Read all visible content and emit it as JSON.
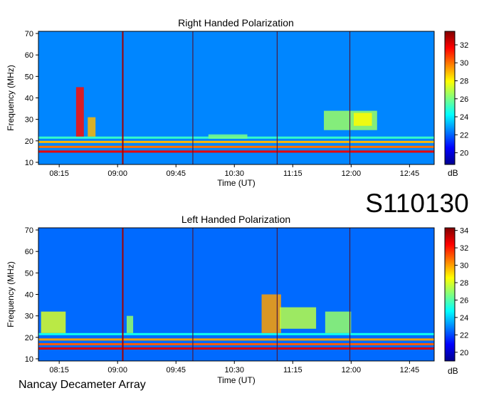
{
  "observatory_label": "Nancay Decameter Array",
  "dataset_code": "S110130",
  "chart_data": [
    {
      "type": "heatmap",
      "title": "Right Handed Polarization",
      "xlabel": "Time (UT)",
      "ylabel": "Frequency (MHz)",
      "x_ticks": [
        "08:15",
        "09:00",
        "09:45",
        "10:30",
        "11:15",
        "12:00",
        "12:45"
      ],
      "x_tick_minutes": [
        495,
        540,
        585,
        630,
        675,
        720,
        765
      ],
      "xlim_minutes": [
        479,
        784
      ],
      "y_ticks": [
        10,
        20,
        30,
        40,
        50,
        60,
        70
      ],
      "ylim": [
        9,
        71
      ],
      "colorbar": {
        "label": "dB",
        "ticks": [
          20,
          22,
          24,
          26,
          28,
          30,
          32
        ],
        "range": [
          18.7,
          33.5
        ]
      },
      "vertical_lines_minutes": [
        544,
        598,
        663,
        719
      ],
      "bursts": [
        {
          "t0": 508,
          "t1": 514,
          "f0": 22,
          "f1": 45,
          "db": 31.5
        },
        {
          "t0": 517,
          "t1": 523,
          "f0": 22,
          "f1": 31,
          "db": 29
        },
        {
          "t0": 610,
          "t1": 640,
          "f0": 21,
          "f1": 23,
          "db": 26
        },
        {
          "t0": 699,
          "t1": 740,
          "f0": 25,
          "f1": 34,
          "db": 26.5
        },
        {
          "t0": 722,
          "t1": 736,
          "f0": 27,
          "f1": 33,
          "db": 28
        }
      ],
      "horizontal_bands": [
        {
          "f": 15,
          "db": 32
        },
        {
          "f": 17.2,
          "db": 30
        },
        {
          "f": 19.5,
          "db": 29
        },
        {
          "f": 21.5,
          "db": 25
        }
      ]
    },
    {
      "type": "heatmap",
      "title": "Left Handed Polarization",
      "xlabel": "Time (UT)",
      "ylabel": "Frequency (MHz)",
      "x_ticks": [
        "08:15",
        "09:00",
        "09:45",
        "10:30",
        "11:15",
        "12:00",
        "12:45"
      ],
      "x_tick_minutes": [
        495,
        540,
        585,
        630,
        675,
        720,
        765
      ],
      "xlim_minutes": [
        479,
        784
      ],
      "y_ticks": [
        10,
        20,
        30,
        40,
        50,
        60,
        70
      ],
      "ylim": [
        9,
        71
      ],
      "colorbar": {
        "label": "dB",
        "ticks": [
          20,
          22,
          24,
          26,
          28,
          30,
          32,
          34
        ],
        "range": [
          19,
          34.3
        ]
      },
      "vertical_lines_minutes": [
        544,
        598,
        663,
        719
      ],
      "bursts": [
        {
          "t0": 481,
          "t1": 500,
          "f0": 22,
          "f1": 32,
          "db": 28
        },
        {
          "t0": 547,
          "t1": 552,
          "f0": 22,
          "f1": 30,
          "db": 27
        },
        {
          "t0": 651,
          "t1": 666,
          "f0": 22,
          "f1": 40,
          "db": 30
        },
        {
          "t0": 665,
          "t1": 693,
          "f0": 24,
          "f1": 34,
          "db": 27.5
        },
        {
          "t0": 700,
          "t1": 720,
          "f0": 22,
          "f1": 32,
          "db": 27
        }
      ],
      "horizontal_bands": [
        {
          "f": 14.8,
          "db": 33
        },
        {
          "f": 16.8,
          "db": 31
        },
        {
          "f": 19,
          "db": 30
        },
        {
          "f": 21.5,
          "db": 25
        }
      ]
    }
  ]
}
